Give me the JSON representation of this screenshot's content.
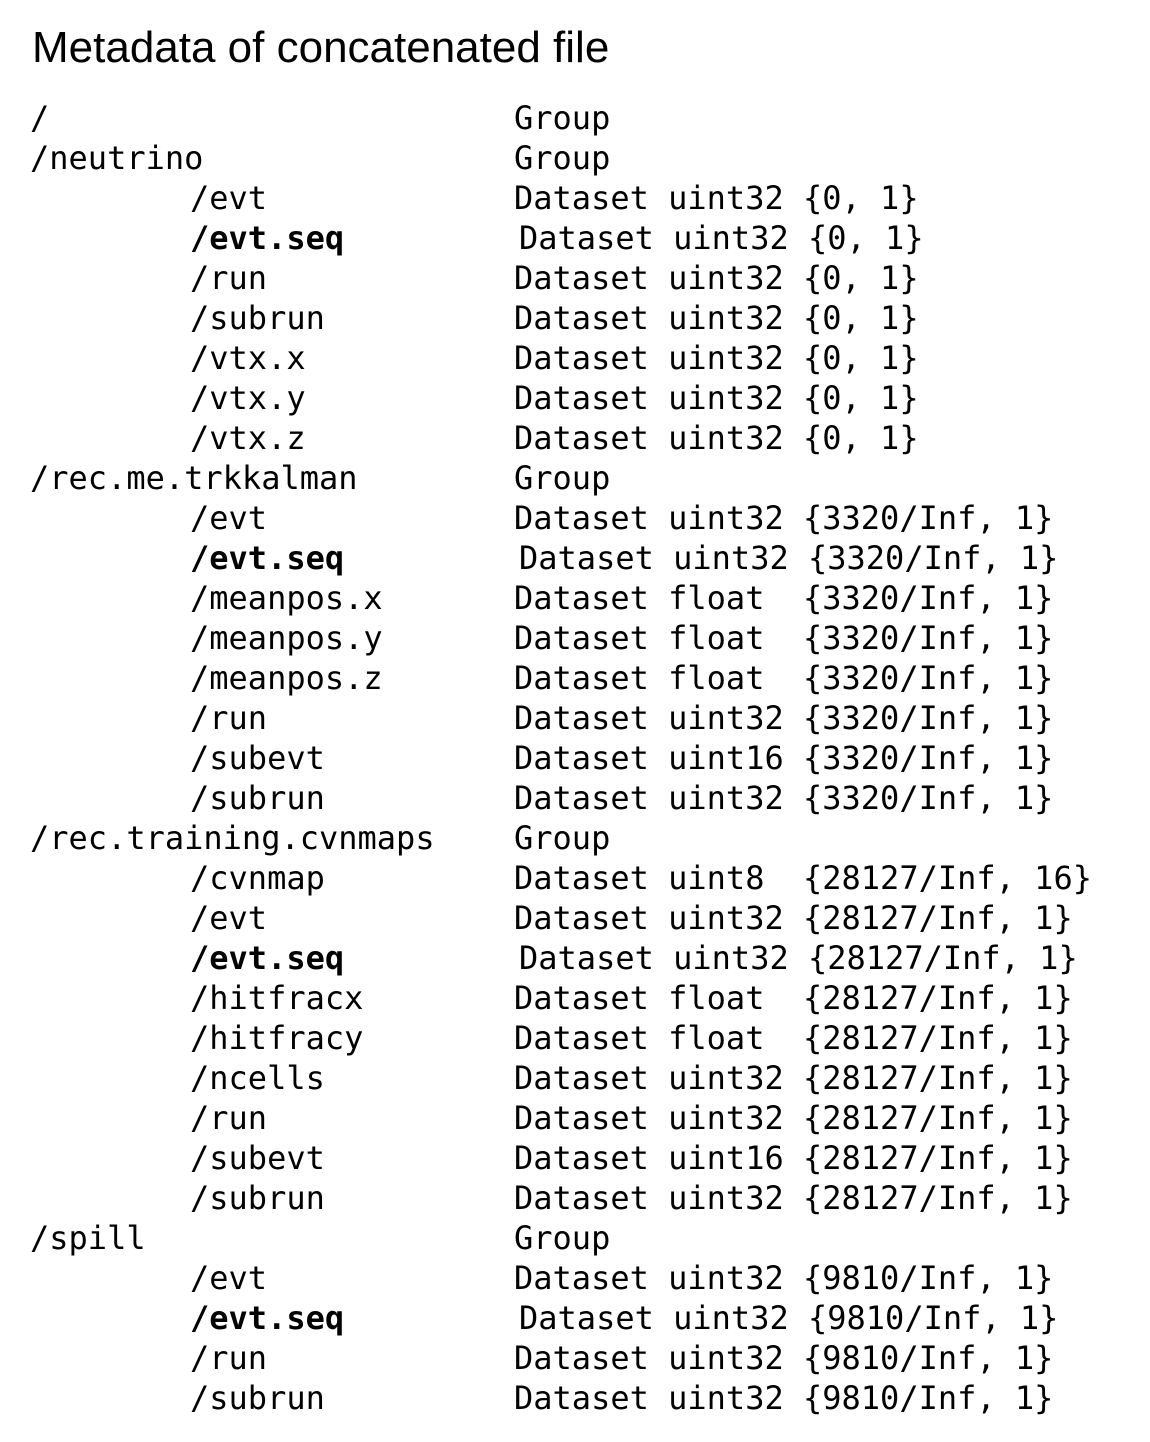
{
  "title": "Metadata of concatenated file",
  "rows": [
    {
      "path": "/",
      "desc": "Group",
      "child": false,
      "emph": false
    },
    {
      "path": "/neutrino",
      "desc": "Group",
      "child": false,
      "emph": false
    },
    {
      "path": "/evt",
      "desc": "Dataset uint32 {0, 1}",
      "child": true,
      "emph": false
    },
    {
      "path": "/evt.seq",
      "desc": "Dataset uint32 {0, 1}",
      "child": true,
      "emph": true
    },
    {
      "path": "/run",
      "desc": "Dataset uint32 {0, 1}",
      "child": true,
      "emph": false
    },
    {
      "path": "/subrun",
      "desc": "Dataset uint32 {0, 1}",
      "child": true,
      "emph": false
    },
    {
      "path": "/vtx.x",
      "desc": "Dataset uint32 {0, 1}",
      "child": true,
      "emph": false
    },
    {
      "path": "/vtx.y",
      "desc": "Dataset uint32 {0, 1}",
      "child": true,
      "emph": false
    },
    {
      "path": "/vtx.z",
      "desc": "Dataset uint32 {0, 1}",
      "child": true,
      "emph": false
    },
    {
      "path": "/rec.me.trkkalman",
      "desc": "Group",
      "child": false,
      "emph": false
    },
    {
      "path": "/evt",
      "desc": "Dataset uint32 {3320/Inf, 1}",
      "child": true,
      "emph": false
    },
    {
      "path": "/evt.seq",
      "desc": "Dataset uint32 {3320/Inf, 1}",
      "child": true,
      "emph": true
    },
    {
      "path": "/meanpos.x",
      "desc": "Dataset float  {3320/Inf, 1}",
      "child": true,
      "emph": false
    },
    {
      "path": "/meanpos.y",
      "desc": "Dataset float  {3320/Inf, 1}",
      "child": true,
      "emph": false
    },
    {
      "path": "/meanpos.z",
      "desc": "Dataset float  {3320/Inf, 1}",
      "child": true,
      "emph": false
    },
    {
      "path": "/run",
      "desc": "Dataset uint32 {3320/Inf, 1}",
      "child": true,
      "emph": false
    },
    {
      "path": "/subevt",
      "desc": "Dataset uint16 {3320/Inf, 1}",
      "child": true,
      "emph": false
    },
    {
      "path": "/subrun",
      "desc": "Dataset uint32 {3320/Inf, 1}",
      "child": true,
      "emph": false
    },
    {
      "path": "/rec.training.cvnmaps",
      "desc": "Group",
      "child": false,
      "emph": false
    },
    {
      "path": "/cvnmap",
      "desc": "Dataset uint8  {28127/Inf, 16}",
      "child": true,
      "emph": false
    },
    {
      "path": "/evt",
      "desc": "Dataset uint32 {28127/Inf, 1}",
      "child": true,
      "emph": false
    },
    {
      "path": "/evt.seq",
      "desc": "Dataset uint32 {28127/Inf, 1}",
      "child": true,
      "emph": true
    },
    {
      "path": "/hitfracx",
      "desc": "Dataset float  {28127/Inf, 1}",
      "child": true,
      "emph": false
    },
    {
      "path": "/hitfracy",
      "desc": "Dataset float  {28127/Inf, 1}",
      "child": true,
      "emph": false
    },
    {
      "path": "/ncells",
      "desc": "Dataset uint32 {28127/Inf, 1}",
      "child": true,
      "emph": false
    },
    {
      "path": "/run",
      "desc": "Dataset uint32 {28127/Inf, 1}",
      "child": true,
      "emph": false
    },
    {
      "path": "/subevt",
      "desc": "Dataset uint16 {28127/Inf, 1}",
      "child": true,
      "emph": false
    },
    {
      "path": "/subrun",
      "desc": "Dataset uint32 {28127/Inf, 1}",
      "child": true,
      "emph": false
    },
    {
      "path": "/spill",
      "desc": "Group",
      "child": false,
      "emph": false
    },
    {
      "path": "/evt",
      "desc": "Dataset uint32 {9810/Inf, 1}",
      "child": true,
      "emph": false
    },
    {
      "path": "/evt.seq",
      "desc": "Dataset uint32 {9810/Inf, 1}",
      "child": true,
      "emph": true
    },
    {
      "path": "/run",
      "desc": "Dataset uint32 {9810/Inf, 1}",
      "child": true,
      "emph": false
    },
    {
      "path": "/subrun",
      "desc": "Dataset uint32 {9810/Inf, 1}",
      "child": true,
      "emph": false
    }
  ]
}
